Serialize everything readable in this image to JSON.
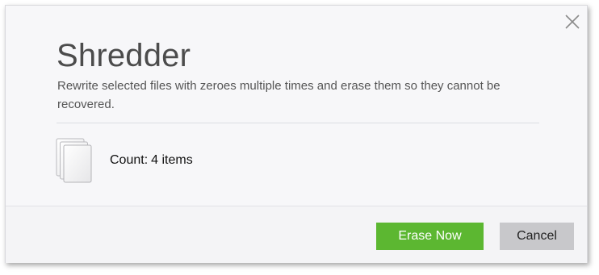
{
  "dialog": {
    "title": "Shredder",
    "description": "Rewrite selected files with zeroes multiple times and erase them so they cannot be recovered.",
    "count_label": "Count:",
    "count_value": "4 items",
    "icons": {
      "close": "close-icon",
      "files": "stacked-files-icon"
    }
  },
  "buttons": {
    "erase_now": "Erase Now",
    "cancel": "Cancel"
  },
  "colors": {
    "primary_button": "#5cb731",
    "secondary_button": "#c8c8cb",
    "title_text": "#4c4c4c"
  }
}
